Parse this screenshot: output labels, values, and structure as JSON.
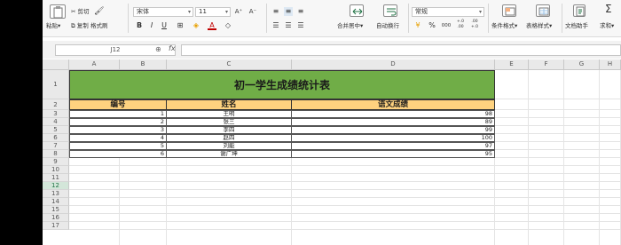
{
  "ribbon": {
    "clipboard": {
      "paste_label": "粘贴",
      "cut_label": "剪切",
      "copy_label": "复制",
      "format_painter_label": "格式刷"
    },
    "font": {
      "name": "宋体",
      "size": "11",
      "bold_glyph": "B",
      "italic_glyph": "I",
      "underline_glyph": "U",
      "font_color_glyph": "A",
      "grow_glyph": "A⁺",
      "shrink_glyph": "A⁻"
    },
    "alignment": {
      "merge_center_label": "合并居中",
      "wrap_text_label": "自动换行"
    },
    "number": {
      "format": "常规",
      "currency_glyph": "¥",
      "percent_glyph": "%",
      "thousands_glyph": "000",
      "increase_decimal_glyph": "+.0 .00",
      "decrease_decimal_glyph": ".00 +.0"
    },
    "styles": {
      "conditional_format_label": "条件格式",
      "table_style_label": "表格样式"
    },
    "tools": {
      "doc_assistant_label": "文档助手",
      "sum_label": "求和"
    }
  },
  "formula_bar": {
    "name_box": "J12",
    "fx_label": "fx",
    "zoom_glyph": "⊕",
    "formula": ""
  },
  "columns": [
    "A",
    "B",
    "C",
    "D",
    "E",
    "F",
    "G",
    "H"
  ],
  "rows": [
    "1",
    "2",
    "3",
    "4",
    "5",
    "6",
    "7",
    "8",
    "9",
    "10",
    "11",
    "12",
    "13",
    "14",
    "15",
    "16",
    "17"
  ],
  "selected_row": "12",
  "table": {
    "title": "初一学生成绩统计表",
    "headers": [
      "编号",
      "姓名",
      "语文成绩"
    ],
    "records": [
      {
        "id": "1",
        "name": "王明",
        "score": "98"
      },
      {
        "id": "2",
        "name": "张三",
        "score": "89"
      },
      {
        "id": "3",
        "name": "李四",
        "score": "99"
      },
      {
        "id": "4",
        "name": "赵四",
        "score": "100"
      },
      {
        "id": "5",
        "name": "刘能",
        "score": "97"
      },
      {
        "id": "6",
        "name": "谢广坤",
        "score": "95"
      }
    ]
  },
  "colors": {
    "title_fill": "#70ad47",
    "header_fill": "#fed27f",
    "selection_accent": "#217346"
  }
}
